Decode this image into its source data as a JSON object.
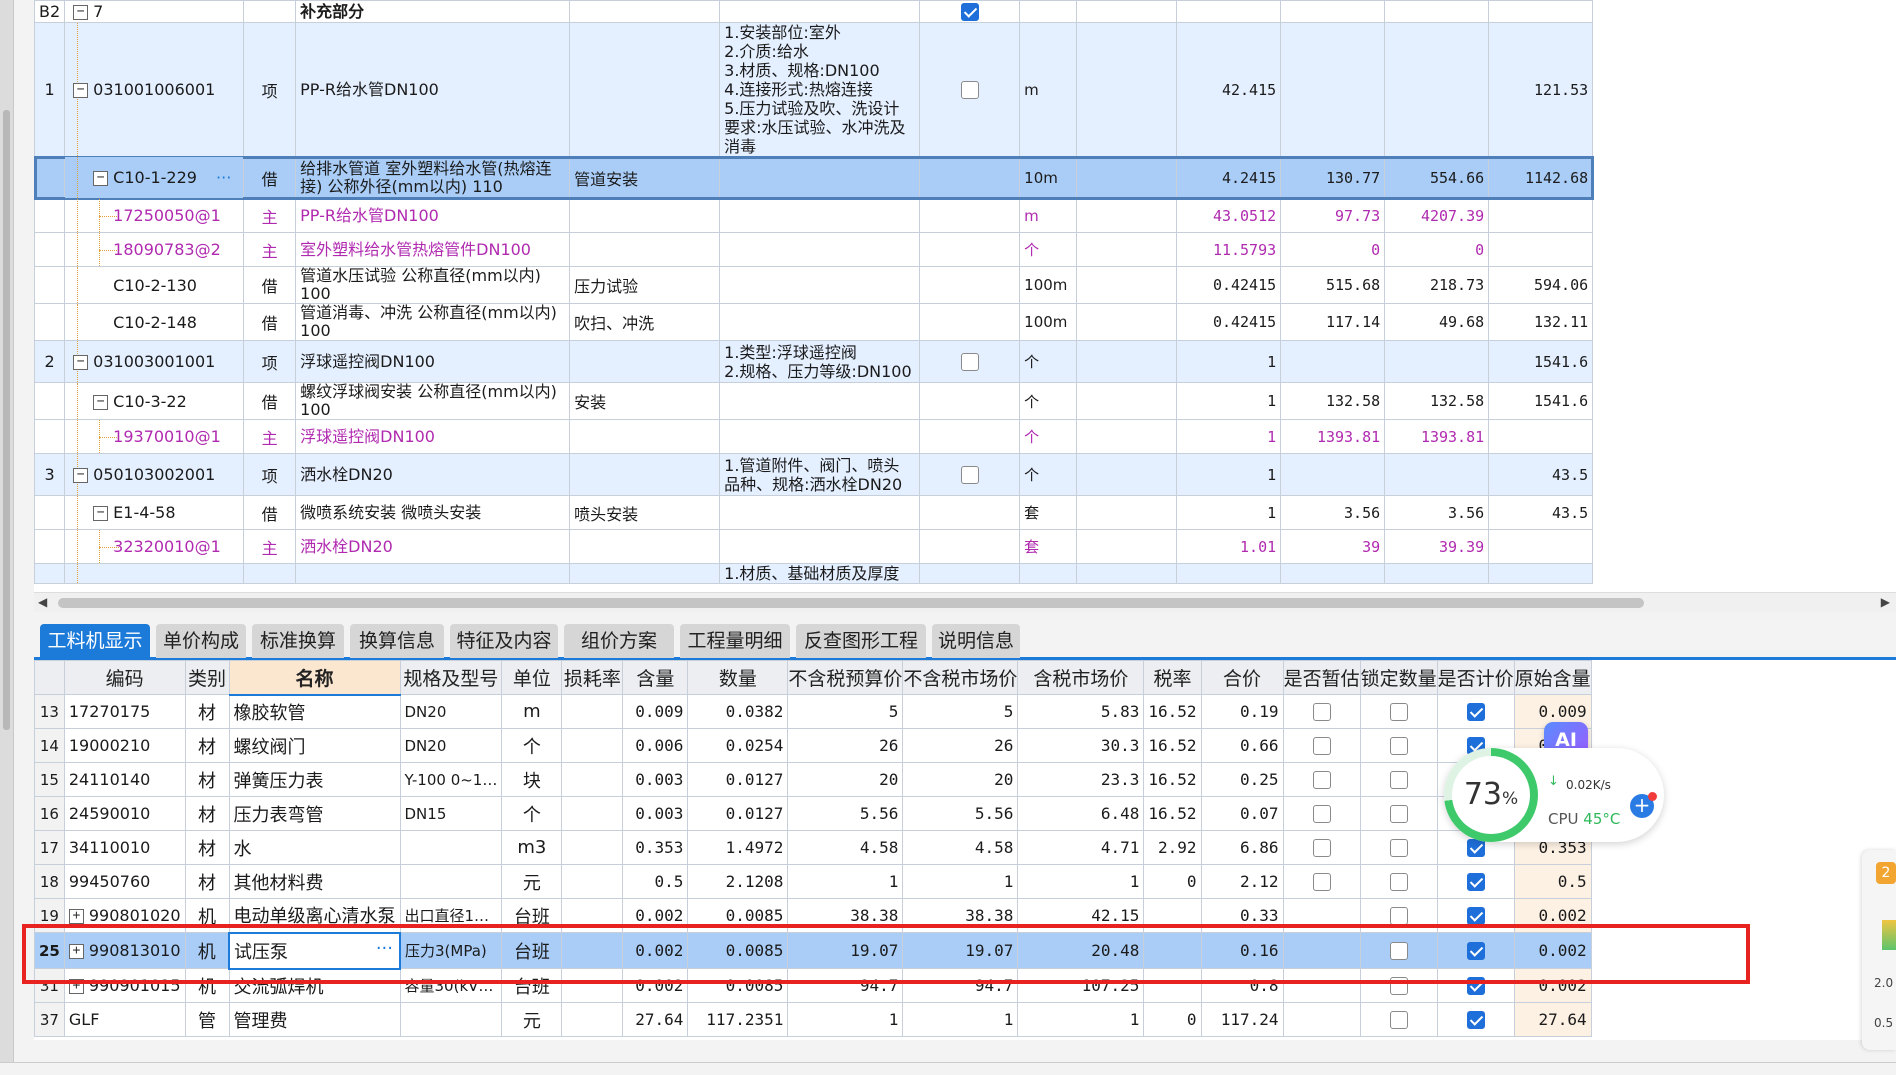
{
  "top_table": {
    "rows": [
      {
        "idx": "B2",
        "code": "7",
        "type": "",
        "name": "补充部分",
        "item": "",
        "features": "",
        "unit": "",
        "qty": "",
        "price": "",
        "total": "",
        "sum": "",
        "chk": true,
        "kind": "head"
      },
      {
        "idx": "1",
        "code": "031001006001",
        "type": "项",
        "name": "PP-R给水管DN100",
        "item": "",
        "features": "1.安装部位:室外\n2.介质:给水\n3.材质、规格:DN100\n4.连接形式:热熔连接\n5.压力试验及吹、洗设计要求:水压试验、水冲洗及消毒",
        "unit": "m",
        "qty": "42.415",
        "price": "",
        "total": "",
        "sum": "121.53",
        "chk": false,
        "kind": "list"
      },
      {
        "idx": "",
        "code": "C10-1-229",
        "type": "借",
        "name": "给排水管道 室外塑料给水管(热熔连接) 公称外径(mm以内) 110",
        "item": "管道安装",
        "features": "",
        "unit": "10m",
        "qty": "4.2415",
        "price": "130.77",
        "total": "554.66",
        "sum": "1142.68",
        "chk": null,
        "kind": "sel"
      },
      {
        "idx": "",
        "code": "17250050@1",
        "type": "主",
        "name": "PP-R给水管DN100",
        "item": "",
        "features": "",
        "unit": "m",
        "qty": "43.0512",
        "price": "97.73",
        "total": "4207.39",
        "sum": "",
        "chk": null,
        "kind": "main"
      },
      {
        "idx": "",
        "code": "18090783@2",
        "type": "主",
        "name": "室外塑料给水管热熔管件DN100",
        "item": "",
        "features": "",
        "unit": "个",
        "qty": "11.5793",
        "price": "0",
        "total": "0",
        "sum": "",
        "chk": null,
        "kind": "main"
      },
      {
        "idx": "",
        "code": "C10-2-130",
        "type": "借",
        "name": "管道水压试验 公称直径(mm以内) 100",
        "item": "压力试验",
        "features": "",
        "unit": "100m",
        "qty": "0.42415",
        "price": "515.68",
        "total": "218.73",
        "sum": "594.06",
        "chk": null,
        "kind": "quota"
      },
      {
        "idx": "",
        "code": "C10-2-148",
        "type": "借",
        "name": "管道消毒、冲洗 公称直径(mm以内) 100",
        "item": "吹扫、冲洗",
        "features": "",
        "unit": "100m",
        "qty": "0.42415",
        "price": "117.14",
        "total": "49.68",
        "sum": "132.11",
        "chk": null,
        "kind": "quota"
      },
      {
        "idx": "2",
        "code": "031003001001",
        "type": "项",
        "name": "浮球遥控阀DN100",
        "item": "",
        "features": "1.类型:浮球遥控阀\n2.规格、压力等级:DN100",
        "unit": "个",
        "qty": "1",
        "price": "",
        "total": "",
        "sum": "1541.6",
        "chk": false,
        "kind": "list"
      },
      {
        "idx": "",
        "code": "C10-3-22",
        "type": "借",
        "name": "螺纹浮球阀安装 公称直径(mm以内) 100",
        "item": "安装",
        "features": "",
        "unit": "个",
        "qty": "1",
        "price": "132.58",
        "total": "132.58",
        "sum": "1541.6",
        "chk": null,
        "kind": "quota"
      },
      {
        "idx": "",
        "code": "19370010@1",
        "type": "主",
        "name": "浮球遥控阀DN100",
        "item": "",
        "features": "",
        "unit": "个",
        "qty": "1",
        "price": "1393.81",
        "total": "1393.81",
        "sum": "",
        "chk": null,
        "kind": "main"
      },
      {
        "idx": "3",
        "code": "050103002001",
        "type": "项",
        "name": "洒水栓DN20",
        "item": "",
        "features": "1.管道附件、阀门、喷头品种、规格:洒水栓DN20",
        "unit": "个",
        "qty": "1",
        "price": "",
        "total": "",
        "sum": "43.5",
        "chk": false,
        "kind": "list"
      },
      {
        "idx": "",
        "code": "E1-4-58",
        "type": "借",
        "name": "微喷系统安装 微喷头安装",
        "item": "喷头安装",
        "features": "",
        "unit": "套",
        "qty": "1",
        "price": "3.56",
        "total": "3.56",
        "sum": "43.5",
        "chk": null,
        "kind": "quota"
      },
      {
        "idx": "",
        "code": "32320010@1",
        "type": "主",
        "name": "洒水栓DN20",
        "item": "",
        "features": "",
        "unit": "套",
        "qty": "1.01",
        "price": "39",
        "total": "39.39",
        "sum": "",
        "chk": null,
        "kind": "main"
      },
      {
        "idx": "",
        "code": "",
        "type": "",
        "name": "",
        "item": "",
        "features": "1.材质、基础材质及厚度",
        "unit": "",
        "qty": "",
        "price": "",
        "total": "",
        "sum": "",
        "chk": null,
        "kind": "list"
      }
    ]
  },
  "tabs": [
    "工料机显示",
    "单价构成",
    "标准换算",
    "换算信息",
    "特征及内容",
    "组价方案",
    "工程量明细",
    "反查图形工程量",
    "说明信息"
  ],
  "bottom_table": {
    "headers": [
      "",
      "编码",
      "类别",
      "名称",
      "规格及型号",
      "单位",
      "损耗率",
      "含量",
      "数量",
      "不含税预算价",
      "不含税市场价",
      "含税市场价",
      "税率",
      "合价",
      "是否暂估",
      "锁定数量",
      "是否计价",
      "原始含量"
    ],
    "rows": [
      {
        "idx": "13",
        "code": "17270175",
        "cat": "材",
        "name": "橡胶软管",
        "spec": "DN20",
        "unit": "m",
        "loss": "",
        "content": "0.009",
        "qty": "0.0382",
        "pre": "5",
        "mkt": "5",
        "taxmkt": "5.83",
        "rate": "16.52",
        "sum": "0.19",
        "est": false,
        "lock": false,
        "priced": true,
        "orig": "0.009",
        "expand": false
      },
      {
        "idx": "14",
        "code": "19000210",
        "cat": "材",
        "name": "螺纹阀门",
        "spec": "DN20",
        "unit": "个",
        "loss": "",
        "content": "0.006",
        "qty": "0.0254",
        "pre": "26",
        "mkt": "26",
        "taxmkt": "30.3",
        "rate": "16.52",
        "sum": "0.66",
        "est": false,
        "lock": false,
        "priced": true,
        "orig": "0.006",
        "expand": false
      },
      {
        "idx": "15",
        "code": "24110140",
        "cat": "材",
        "name": "弹簧压力表",
        "spec": "Y-100 0~1…",
        "unit": "块",
        "loss": "",
        "content": "0.003",
        "qty": "0.0127",
        "pre": "20",
        "mkt": "20",
        "taxmkt": "23.3",
        "rate": "16.52",
        "sum": "0.25",
        "est": false,
        "lock": false,
        "priced": true,
        "orig": "0.003",
        "expand": false
      },
      {
        "idx": "16",
        "code": "24590010",
        "cat": "材",
        "name": "压力表弯管",
        "spec": "DN15",
        "unit": "个",
        "loss": "",
        "content": "0.003",
        "qty": "0.0127",
        "pre": "5.56",
        "mkt": "5.56",
        "taxmkt": "6.48",
        "rate": "16.52",
        "sum": "0.07",
        "est": false,
        "lock": false,
        "priced": true,
        "orig": "0.003",
        "expand": false
      },
      {
        "idx": "17",
        "code": "34110010",
        "cat": "材",
        "name": "水",
        "spec": "",
        "unit": "m3",
        "loss": "",
        "content": "0.353",
        "qty": "1.4972",
        "pre": "4.58",
        "mkt": "4.58",
        "taxmkt": "4.71",
        "rate": "2.92",
        "sum": "6.86",
        "est": false,
        "lock": false,
        "priced": true,
        "orig": "0.353",
        "expand": false
      },
      {
        "idx": "18",
        "code": "99450760",
        "cat": "材",
        "name": "其他材料费",
        "spec": "",
        "unit": "元",
        "loss": "",
        "content": "0.5",
        "qty": "2.1208",
        "pre": "1",
        "mkt": "1",
        "taxmkt": "1",
        "rate": "0",
        "sum": "2.12",
        "est": false,
        "lock": false,
        "priced": true,
        "orig": "0.5",
        "expand": false
      },
      {
        "idx": "19",
        "code": "990801020",
        "cat": "机",
        "name": "电动单级离心清水泵",
        "spec": "出口直径1…",
        "unit": "台班",
        "loss": "",
        "content": "0.002",
        "qty": "0.0085",
        "pre": "38.38",
        "mkt": "38.38",
        "taxmkt": "42.15",
        "rate": "",
        "sum": "0.33",
        "est": null,
        "lock": false,
        "priced": true,
        "orig": "0.002",
        "expand": true
      },
      {
        "idx": "25",
        "code": "990813010",
        "cat": "机",
        "name": "试压泵",
        "spec": "压力3(MPa)",
        "unit": "台班",
        "loss": "",
        "content": "0.002",
        "qty": "0.0085",
        "pre": "19.07",
        "mkt": "19.07",
        "taxmkt": "20.48",
        "rate": "",
        "sum": "0.16",
        "est": null,
        "lock": false,
        "priced": true,
        "orig": "0.002",
        "expand": true,
        "sel": true
      },
      {
        "idx": "31",
        "code": "990901015",
        "cat": "机",
        "name": "交流弧焊机",
        "spec": "容量30(kV…",
        "unit": "台班",
        "loss": "",
        "content": "0.002",
        "qty": "0.0085",
        "pre": "94.7",
        "mkt": "94.7",
        "taxmkt": "107.25",
        "rate": "",
        "sum": "0.8",
        "est": null,
        "lock": false,
        "priced": true,
        "orig": "0.002",
        "expand": true
      },
      {
        "idx": "37",
        "code": "GLF",
        "cat": "管",
        "name": "管理费",
        "spec": "",
        "unit": "元",
        "loss": "",
        "content": "27.64",
        "qty": "117.2351",
        "pre": "1",
        "mkt": "1",
        "taxmkt": "1",
        "rate": "0",
        "sum": "117.24",
        "est": null,
        "lock": false,
        "priced": true,
        "orig": "27.64",
        "expand": false
      }
    ]
  },
  "monitor": {
    "percent": "73",
    "percent_unit": "%",
    "net": "0.02K/s",
    "cpu_label": "CPU",
    "cpu_temp": "45°C",
    "ai_label": "AI"
  },
  "edge": {
    "badge": "2",
    "t1": "2.0",
    "t2": "0.5"
  },
  "colors": {
    "accent": "#1c7ad9",
    "selection": "#a9cdf7",
    "list_row": "#e4efff",
    "main_material": "#b02ab0",
    "highlight_box": "#e8231f"
  }
}
